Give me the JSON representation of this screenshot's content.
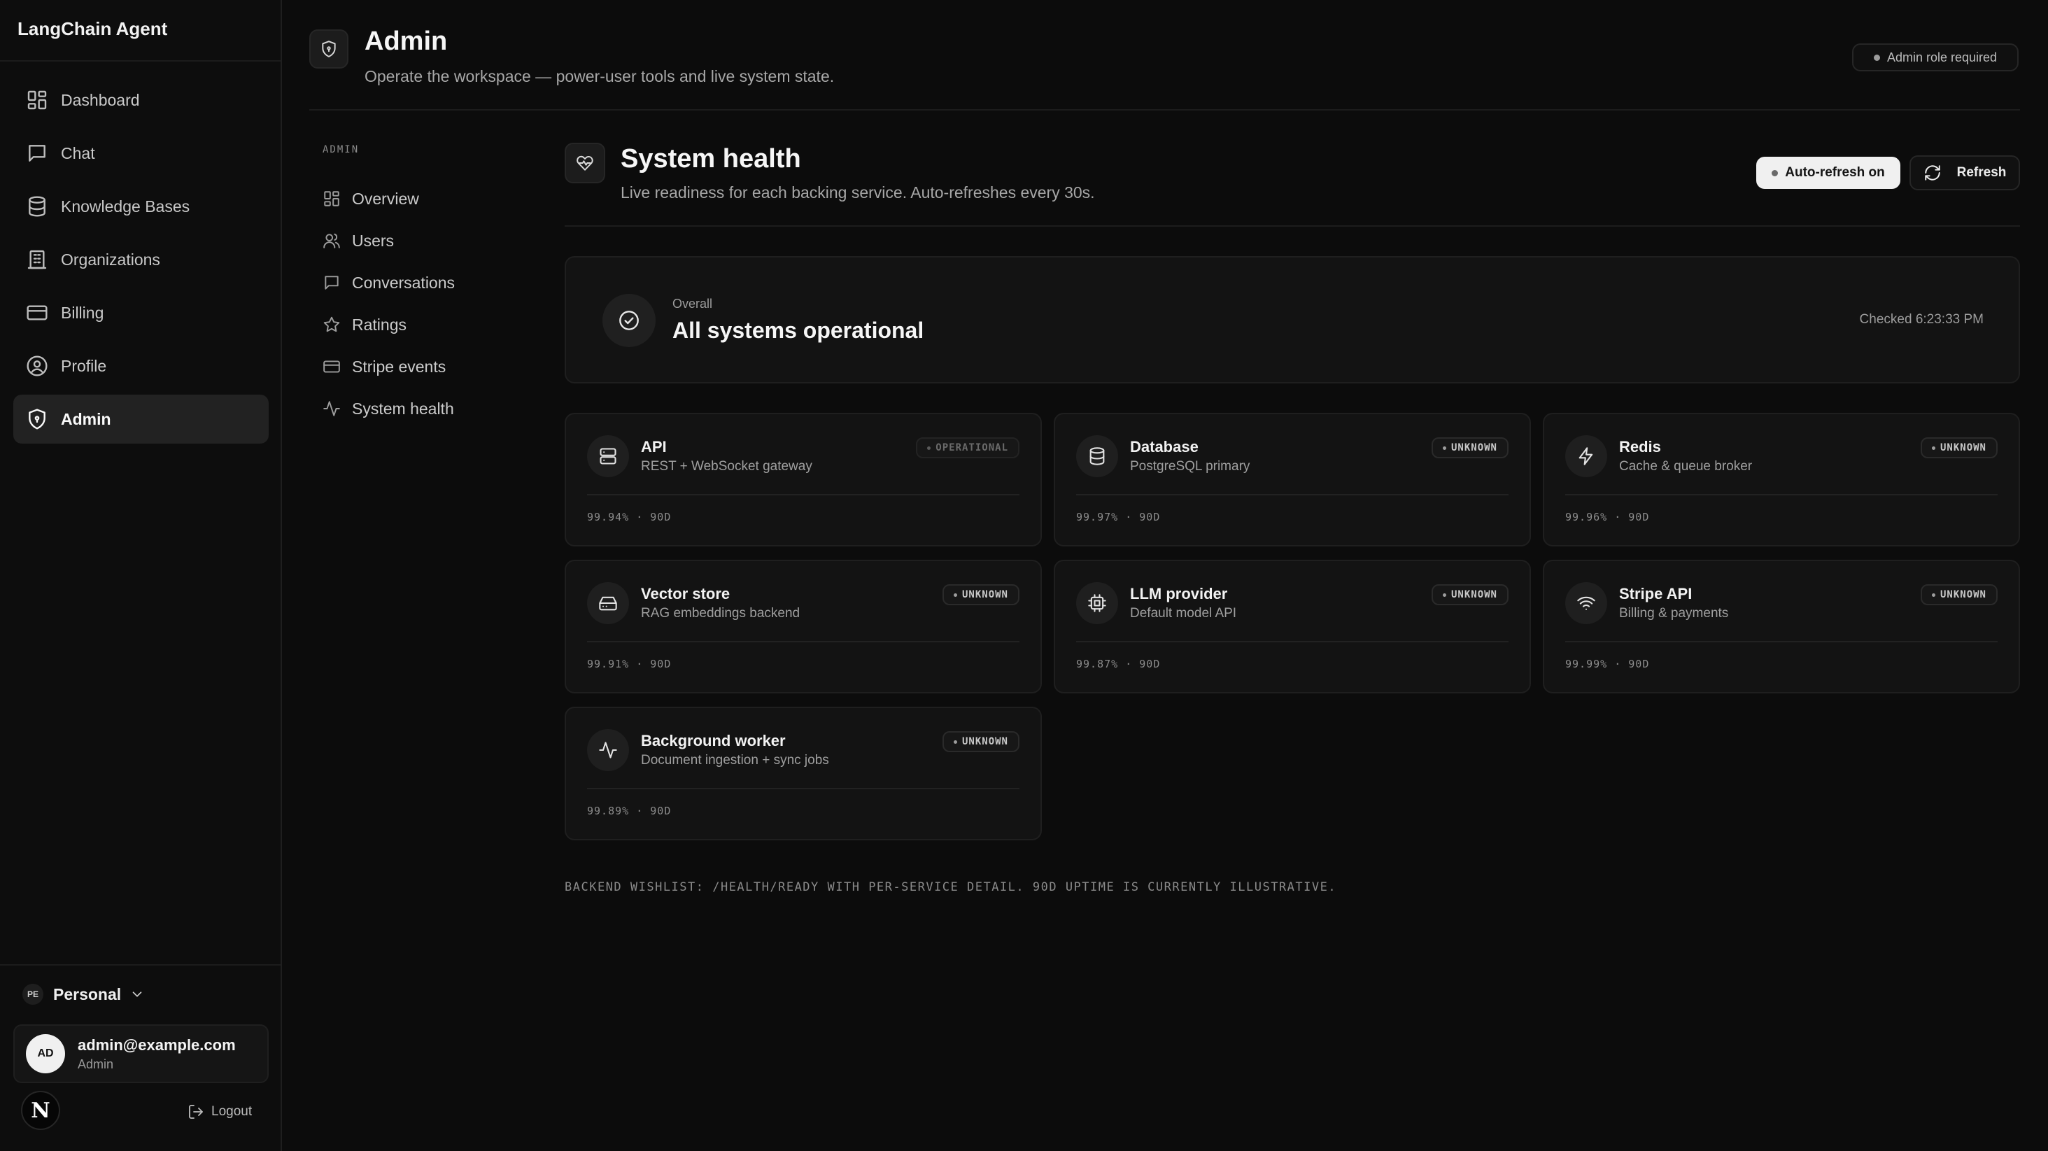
{
  "app": {
    "title": "LangChain Agent"
  },
  "sidebar": {
    "items": [
      {
        "label": "Dashboard",
        "icon": "dashboard-icon"
      },
      {
        "label": "Chat",
        "icon": "chat-icon"
      },
      {
        "label": "Knowledge Bases",
        "icon": "database-icon"
      },
      {
        "label": "Organizations",
        "icon": "building-icon"
      },
      {
        "label": "Billing",
        "icon": "card-icon"
      },
      {
        "label": "Profile",
        "icon": "user-circle-icon"
      },
      {
        "label": "Admin",
        "icon": "shield-icon",
        "active": true
      }
    ],
    "org": {
      "badge": "PE",
      "name": "Personal"
    },
    "user": {
      "initials": "AD",
      "email": "admin@example.com",
      "role": "Admin"
    },
    "logo_letter": "N",
    "logout_label": "Logout"
  },
  "header": {
    "title": "Admin",
    "subtitle": "Operate the workspace — power-user tools and live system state.",
    "role_chip": "Admin role required"
  },
  "admin_nav": {
    "section_label": "ADMIN",
    "items": [
      {
        "label": "Overview",
        "icon": "grid-icon"
      },
      {
        "label": "Users",
        "icon": "users-icon"
      },
      {
        "label": "Conversations",
        "icon": "message-icon"
      },
      {
        "label": "Ratings",
        "icon": "star-icon"
      },
      {
        "label": "Stripe events",
        "icon": "credit-card-icon"
      },
      {
        "label": "System health",
        "icon": "activity-icon"
      }
    ]
  },
  "health": {
    "title": "System health",
    "subtitle": "Live readiness for each backing service. Auto-refreshes every 30s.",
    "auto_refresh_label": "Auto-refresh on",
    "refresh_label": "Refresh",
    "overall": {
      "label": "Overall",
      "status": "All systems operational",
      "checked": "Checked 6:23:33 PM"
    },
    "services": [
      {
        "name": "API",
        "desc": "REST + WebSocket gateway",
        "status": "OPERATIONAL",
        "uptime": "99.94% · 90D",
        "icon": "server-icon"
      },
      {
        "name": "Database",
        "desc": "PostgreSQL primary",
        "status": "UNKNOWN",
        "uptime": "99.97% · 90D",
        "icon": "database-icon"
      },
      {
        "name": "Redis",
        "desc": "Cache & queue broker",
        "status": "UNKNOWN",
        "uptime": "99.96% · 90D",
        "icon": "zap-icon"
      },
      {
        "name": "Vector store",
        "desc": "RAG embeddings backend",
        "status": "UNKNOWN",
        "uptime": "99.91% · 90D",
        "icon": "hard-drive-icon"
      },
      {
        "name": "LLM provider",
        "desc": "Default model API",
        "status": "UNKNOWN",
        "uptime": "99.87% · 90D",
        "icon": "cpu-icon"
      },
      {
        "name": "Stripe API",
        "desc": "Billing & payments",
        "status": "UNKNOWN",
        "uptime": "99.99% · 90D",
        "icon": "wifi-icon"
      },
      {
        "name": "Background worker",
        "desc": "Document ingestion + sync jobs",
        "status": "UNKNOWN",
        "uptime": "99.89% · 90D",
        "icon": "activity-icon"
      }
    ],
    "footnote": "BACKEND WISHLIST: /HEALTH/READY WITH PER-SERVICE DETAIL. 90D UPTIME IS CURRENTLY ILLUSTRATIVE."
  }
}
